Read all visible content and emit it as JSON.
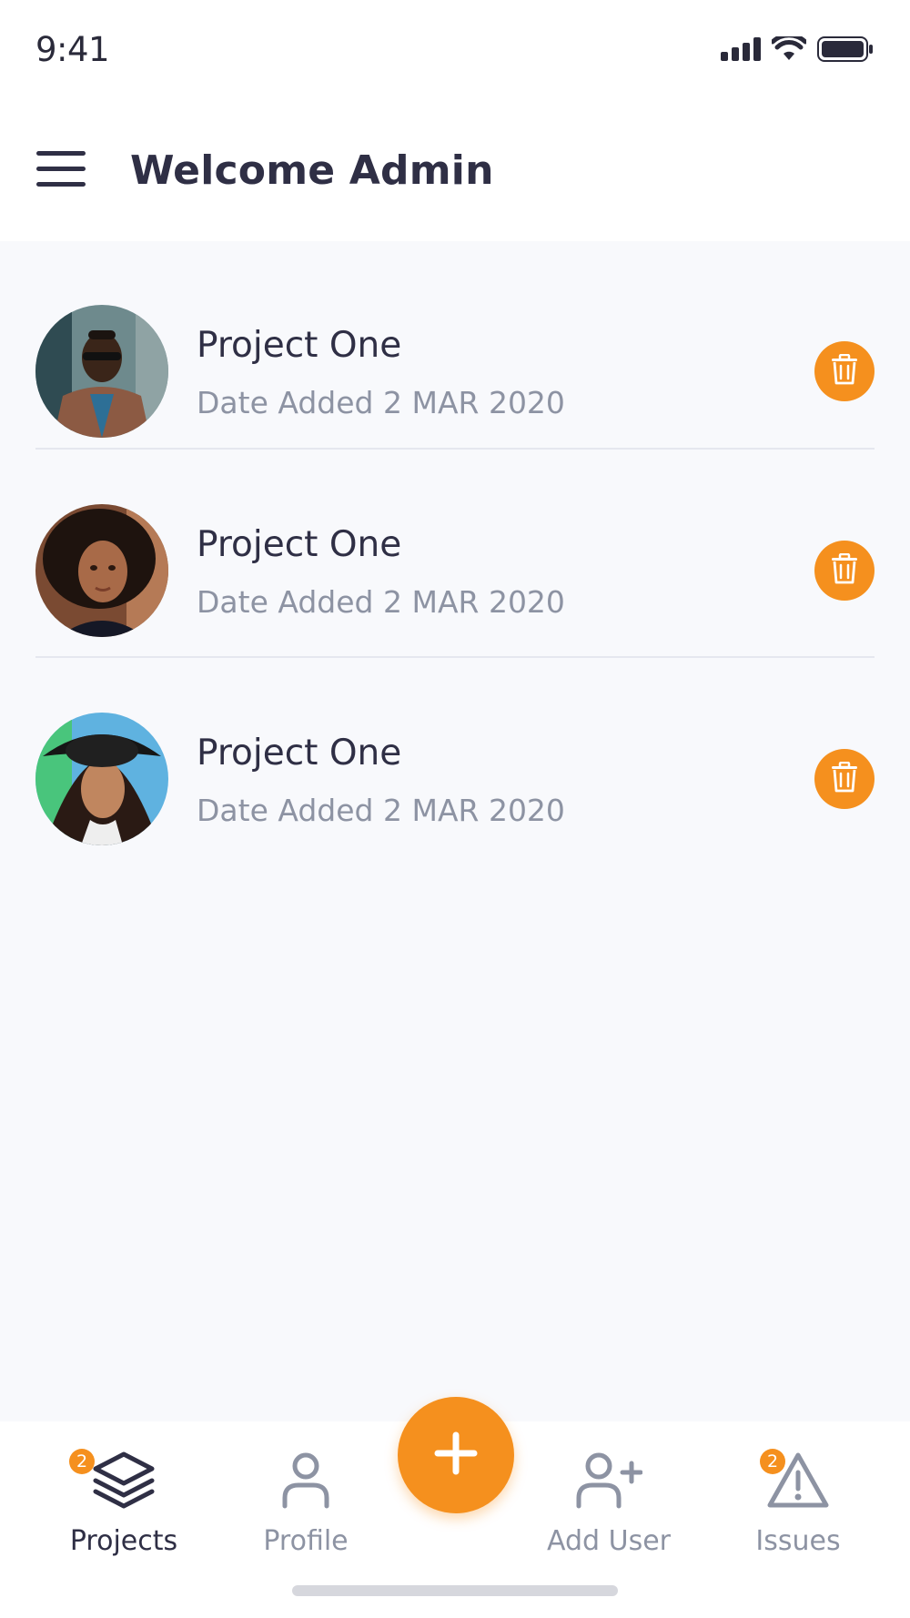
{
  "status_bar": {
    "time": "9:41",
    "icons": [
      "signal-icon",
      "wifi-icon",
      "battery-icon"
    ]
  },
  "header": {
    "title": "Welcome Admin",
    "menu_icon": "menu-icon"
  },
  "projects": [
    {
      "name": "Project One",
      "date": "Date Added 2 MAR 2020",
      "delete_icon": "trash-icon"
    },
    {
      "name": "Project One",
      "date": "Date Added 2 MAR 2020",
      "delete_icon": "trash-icon"
    },
    {
      "name": "Project One",
      "date": "Date Added 2 MAR 2020",
      "delete_icon": "trash-icon"
    }
  ],
  "bottom_nav": {
    "items": [
      {
        "label": "Projects",
        "icon": "layers-icon",
        "badge": "2",
        "active": true
      },
      {
        "label": "Profile",
        "icon": "user-icon",
        "badge": "",
        "active": false
      },
      {
        "label": "Add User",
        "icon": "user-plus-icon",
        "badge": "",
        "active": false
      },
      {
        "label": "Issues",
        "icon": "warning-icon",
        "badge": "2",
        "active": false
      }
    ],
    "fab_icon": "plus-icon"
  },
  "colors": {
    "accent": "#f5901e",
    "text_primary": "#2f2f45",
    "text_secondary": "#8d93a3",
    "background": "#f8f9fc"
  }
}
